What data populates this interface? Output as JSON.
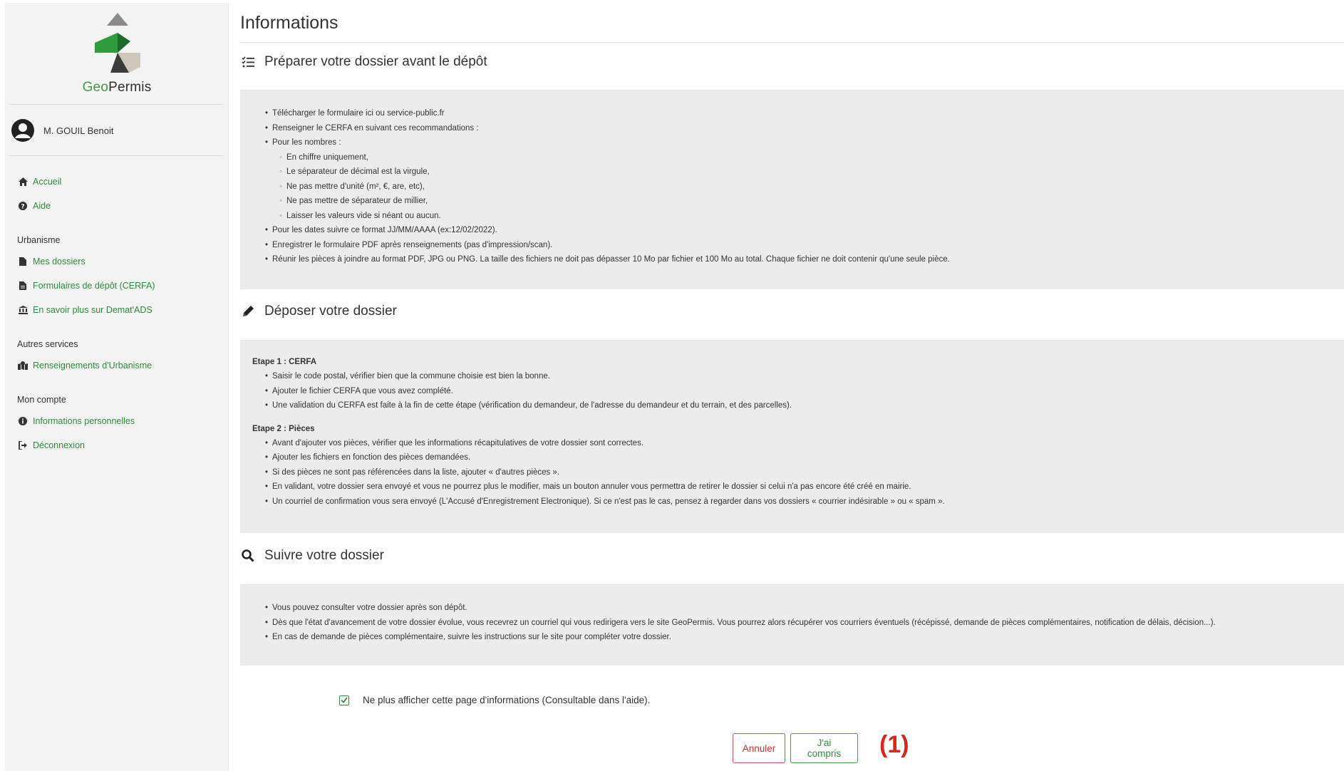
{
  "brand": {
    "geo": "Geo",
    "permis": "Permis"
  },
  "user": {
    "name": "M. GOUIL Benoit"
  },
  "nav": {
    "accueil": "Accueil",
    "aide": "Aide",
    "urbanisme_head": "Urbanisme",
    "mes_dossiers": "Mes dossiers",
    "formulaires": "Formulaires de dépôt (CERFA)",
    "demat": "En savoir plus sur Demat'ADS",
    "autres_head": "Autres services",
    "renseignements": "Renseignements d'Urbanisme",
    "compte_head": "Mon compte",
    "infos_perso": "Informations personnelles",
    "deconnexion": "Déconnexion"
  },
  "page": {
    "title": "Informations"
  },
  "section1": {
    "title": "Préparer votre dossier avant le dépôt",
    "items": [
      "Télécharger le formulaire ici ou service-public.fr",
      "Renseigner le CERFA en suivant ces recommandations :",
      "Pour les nombres :"
    ],
    "subitems": [
      "En chiffre uniquement,",
      "Le séparateur de décimal est la virgule,",
      "Ne pas mettre d'unité (m², €, are, etc),",
      "Ne pas mettre de séparateur de millier,",
      "Laisser les valeurs vide si néant ou aucun."
    ],
    "items2": [
      "Pour les dates suivre ce format JJ/MM/AAAA (ex:12/02/2022).",
      "Enregistrer le formulaire PDF après renseignements (pas d'impression/scan).",
      "Réunir les pièces à joindre au format PDF, JPG ou PNG. La taille des fichiers ne doit pas dépasser 10 Mo par fichier et 100 Mo au total. Chaque fichier ne doit contenir qu'une seule pièce."
    ]
  },
  "section2": {
    "title": "Déposer votre dossier",
    "step1_title": "Etape 1 : CERFA",
    "step1_items": [
      "Saisir le code postal, vérifier bien que la commune choisie est bien la bonne.",
      "Ajouter le fichier CERFA que vous avez complété.",
      "Une validation du CERFA est faite à la fin de cette étape (vérification du demandeur, de l'adresse du demandeur et du terrain, et des parcelles)."
    ],
    "step2_title": "Etape 2 : Pièces",
    "step2_items": [
      "Avant d'ajouter vos pièces, vérifier que les informations récapitulatives de votre dossier sont correctes.",
      "Ajouter les fichiers en fonction des pièces demandées.",
      "Si des pièces ne sont pas référencées dans la liste, ajouter « d'autres pièces ».",
      "En validant, votre dossier sera envoyé et vous ne pourrez plus le modifier, mais un bouton annuler vous permettra de retirer le dossier si celui n'a pas encore été créé en mairie.",
      "Un courriel de confirmation vous sera envoyé (L'Accusé d'Enregistrement Electronique). Si ce n'est pas le cas, pensez à regarder dans vos dossiers « courrier indésirable » ou « spam »."
    ]
  },
  "section3": {
    "title": "Suivre votre dossier",
    "items": [
      "Vous pouvez consulter votre dossier après son dépôt.",
      "Dès que l'état d'avancement de votre dossier évolue, vous recevrez un courriel qui vous redirigera vers le site GeoPermis. Vous pourrez alors récupérer vos courriers éventuels (récépissé, demande de pièces complémentaires, notification de délais, décision...).",
      "En cas de demande de pièces complémentaire, suivre les instructions sur le site pour compléter votre dossier."
    ]
  },
  "footer": {
    "checkbox_label": "Ne plus afficher cette page d'informations (Consultable dans l'aide).",
    "checkbox_checked": true,
    "cancel_label": "Annuler",
    "ok_label": "J'ai compris",
    "annotation": "(1)"
  },
  "colors": {
    "accent": "#3f9b44",
    "danger": "#d9534f",
    "annotation": "#d42a1e",
    "panel": "#ececec",
    "sidebar": "#f3f3f3"
  }
}
